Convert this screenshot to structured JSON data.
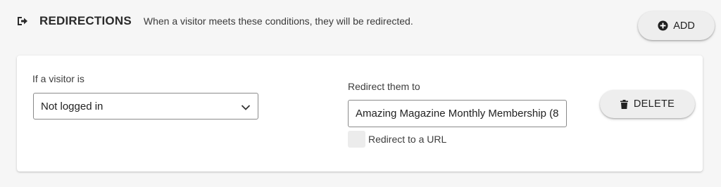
{
  "header": {
    "icon": "sign-out-icon",
    "title": "REDIRECTIONS",
    "description": "When a visitor meets these conditions, they will be redirected."
  },
  "add_button": {
    "icon": "plus-circle-icon",
    "label": "ADD"
  },
  "rule": {
    "condition_label": "If a visitor is",
    "condition_value": "Not logged in",
    "redirect_label": "Redirect them to",
    "redirect_value": "Amazing Magazine Monthly Membership (8",
    "redirect_to_url_label": "Redirect to a URL",
    "redirect_to_url_checked": false,
    "delete_button": {
      "icon": "trash-icon",
      "label": "DELETE"
    }
  }
}
